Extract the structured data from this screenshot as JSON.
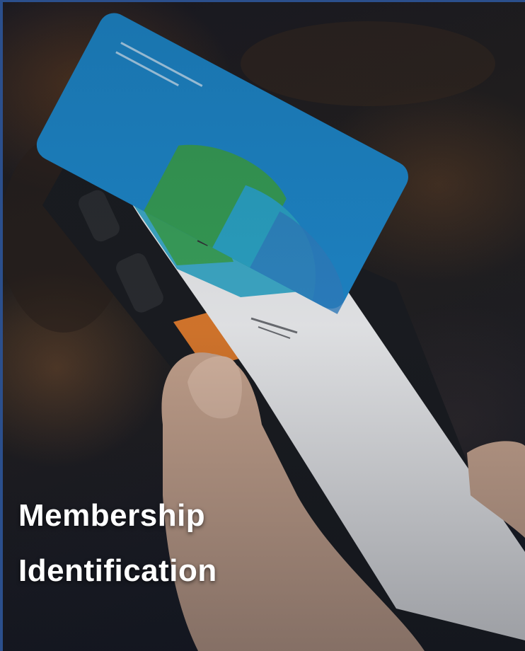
{
  "caption": {
    "line1": "Membership",
    "line2": "Identification"
  },
  "colors": {
    "card_blue": "#1d86c8",
    "card_green": "#3aa048",
    "card_teal": "#2aa3c4",
    "device_orange": "#d9782c",
    "screen_white": "#e9eaec",
    "frame_accent": "#2b4f8c",
    "text": "#ffffff"
  }
}
